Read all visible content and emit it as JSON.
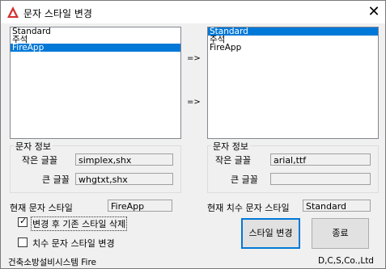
{
  "window": {
    "title": "문자 스타일 변경",
    "close_glyph": "✕"
  },
  "lists": {
    "left": {
      "items": [
        {
          "label": "Standard",
          "selected": false
        },
        {
          "label": "주석",
          "selected": false
        },
        {
          "label": "FireApp",
          "selected": true
        }
      ]
    },
    "right": {
      "items": [
        {
          "label": "Standard",
          "selected": true
        },
        {
          "label": "주석",
          "selected": false
        },
        {
          "label": "FireApp",
          "selected": false
        }
      ]
    },
    "arrow_top": "=>",
    "arrow_bottom": "=>"
  },
  "left_info": {
    "group_title": "문자 정보",
    "small_font_label": "작은 글꼴",
    "small_font_value": "simplex,shx",
    "big_font_label": "큰 글꼴",
    "big_font_value": "whgtxt,shx"
  },
  "right_info": {
    "group_title": "문자 정보",
    "small_font_label": "작은 글꼴",
    "small_font_value": "arial,ttf",
    "big_font_label": "큰 글꼴",
    "big_font_value": ""
  },
  "current": {
    "text_style_label": "현재 문자 스타일",
    "text_style_value": "FireApp",
    "dim_text_style_label": "현재 치수 문자 스타일",
    "dim_text_style_value": "Standard"
  },
  "options": {
    "delete_existing": {
      "label": "변경 후 기존 스타일 삭제",
      "checked": true
    },
    "change_dim_style": {
      "label": "치수 문자 스타일 변경",
      "checked": false
    }
  },
  "buttons": {
    "change_style": "스타일 변경",
    "exit": "종료"
  },
  "footer": {
    "left": "건축소방설비시스템 Fire",
    "right": "D,C,S,Co.,Ltd"
  },
  "colors": {
    "selection": "#0078d7",
    "app_icon": "#d32f2f"
  }
}
